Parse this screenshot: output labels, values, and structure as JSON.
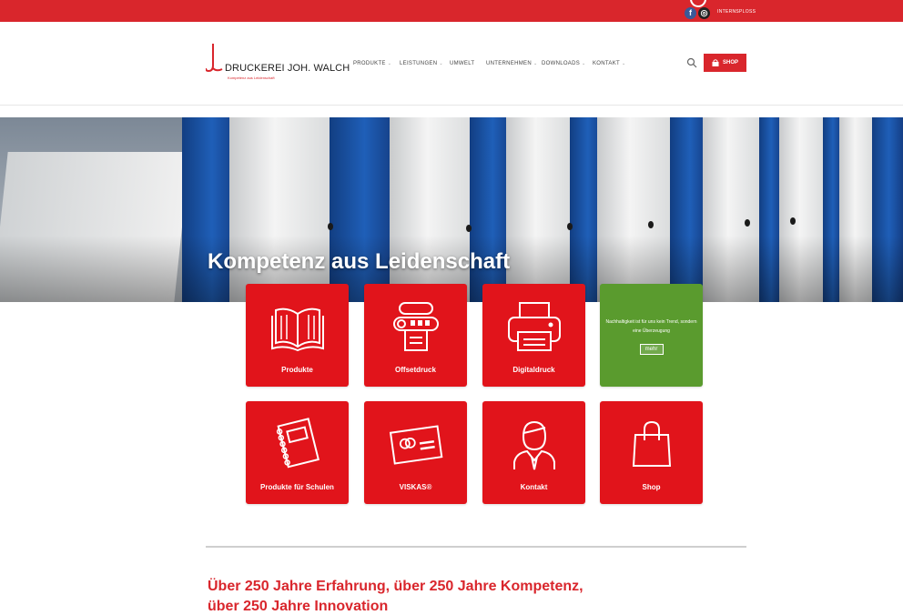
{
  "topbar": {
    "facebook_glyph": "f",
    "instagram_glyph": "◎",
    "intranet": "INTERNSPLOSS"
  },
  "header": {
    "logo_name": "DRUCKEREI JOH. WALCH",
    "logo_tagline": "Kompetenz aus Leidenschaft",
    "nav": [
      {
        "label": "PRODUKTE",
        "has_dropdown": true
      },
      {
        "label": "LEISTUNGEN",
        "has_dropdown": true
      },
      {
        "label": "UMWELT",
        "has_dropdown": false
      },
      {
        "label": "UNTERNEHMEN",
        "has_dropdown": true
      },
      {
        "label": "DOWNLOADS",
        "has_dropdown": true
      },
      {
        "label": "KONTAKT",
        "has_dropdown": true
      }
    ],
    "dropdown_glyph": "⌄",
    "shop_label": "SHOP"
  },
  "hero": {
    "title": "Kompetenz aus Leidenschaft"
  },
  "tiles": {
    "produkte": "Produkte",
    "offsetdruck": "Offsetdruck",
    "digitaldruck": "Digitaldruck",
    "nachhaltigkeit_text": "Nachhaltigkeit ist für uns kein Trend, sondern eine Überzeugung",
    "nachhaltigkeit_button": "mehr",
    "schulen": "Produkte für Schulen",
    "viskas": "VISKAS®",
    "kontakt": "Kontakt",
    "shop": "Shop"
  },
  "intro": {
    "line1": "Über 250 Jahre Erfahrung, über 250 Jahre Kompetenz,",
    "line2": "über 250 Jahre Innovation"
  },
  "colors": {
    "brand_red": "#d9262c",
    "tile_red": "#e1141b",
    "green": "#5a9b2e"
  }
}
